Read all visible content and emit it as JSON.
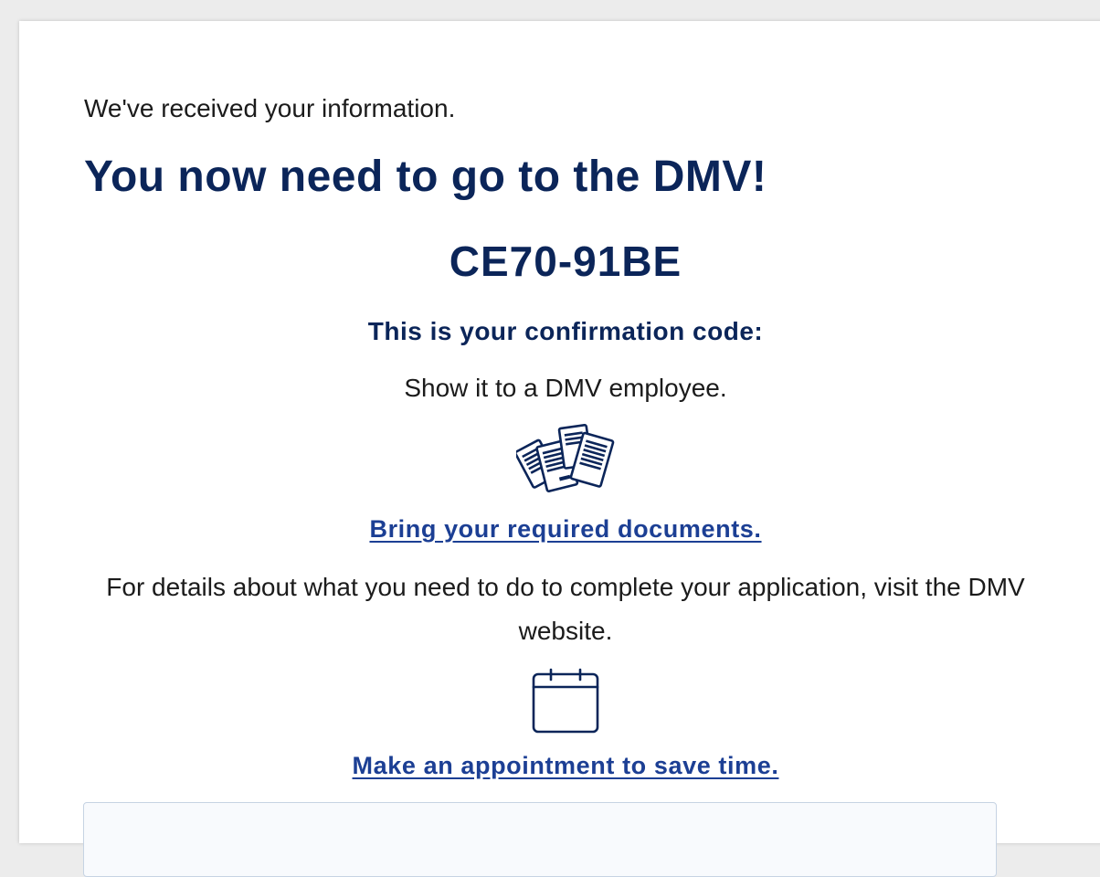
{
  "status": {
    "received_text": "We've received your information."
  },
  "headline": {
    "title": "You now need to go to the DMV!"
  },
  "confirmation": {
    "code": "CE70-91BE",
    "label": "This is your confirmation code:",
    "instruction": "Show it to a DMV employee."
  },
  "documents": {
    "icon": "documents-icon",
    "link_text": "Bring your required documents."
  },
  "details": {
    "text": "For details about what you need to do to complete your application, visit the DMV website."
  },
  "appointment": {
    "icon": "calendar-icon",
    "link_text": "Make an appointment to save time."
  },
  "colors": {
    "heading": "#0b2559",
    "link": "#1c3f94",
    "body_text": "#1b1b1b"
  }
}
